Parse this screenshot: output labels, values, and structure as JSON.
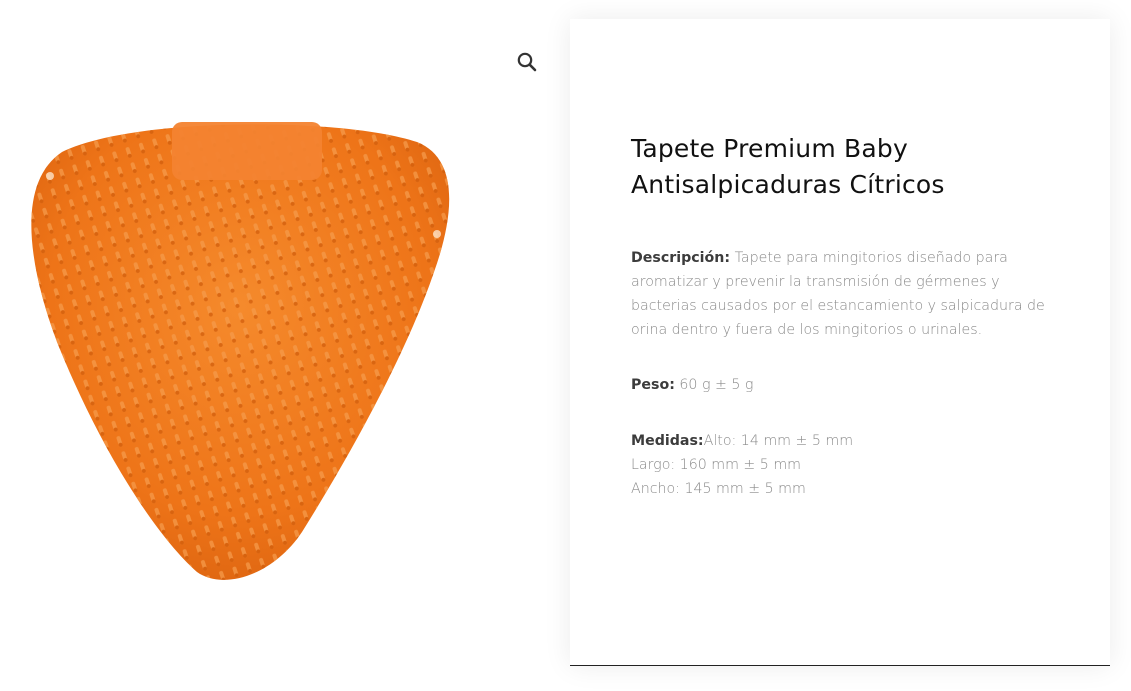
{
  "gallery": {
    "zoom_icon": "search-icon",
    "product_image_alt": "",
    "product_color": "#f07a1e"
  },
  "product": {
    "title": "Tapete Premium Baby Antisalpicaduras Cítricos",
    "description_label": "Descripción:",
    "description_text": " Tapete para mingitorios diseñado para aromatizar y prevenir la transmisión de gérmenes y bacterias causados por el estancamiento y salpicadura de orina dentro y fuera de los mingitorios o urinales.",
    "weight_label": "Peso:",
    "weight_text": " 60 g ± 5 g",
    "dimensions_label": "Medidas:",
    "dimensions_lines": [
      "Alto: 14 mm ± 5 mm",
      "Largo: 160 mm ± 5 mm",
      "Ancho: 145 mm ± 5 mm"
    ]
  }
}
